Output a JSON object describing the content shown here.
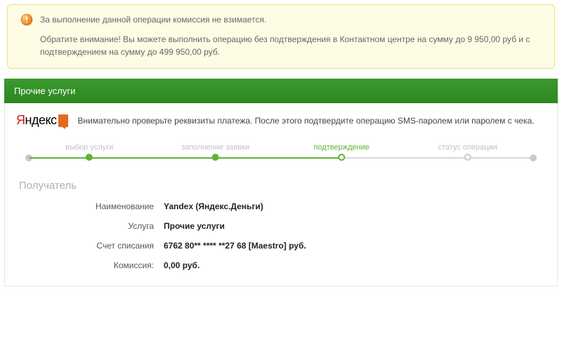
{
  "notice": {
    "line1": "За выполнение данной операции комиссия не взимается.",
    "line2": "Обратите внимание! Вы можете выполнить операцию без подтверждения в Контактном центре на сумму до 9 950,00 руб и с подтверждением на сумму до 499 950,00 руб."
  },
  "section_title": "Прочие услуги",
  "provider": {
    "logo_text_black": "ндекс",
    "logo_text_red": "Я"
  },
  "instructions": "Внимательно проверьте реквизиты платежа. После этого подтвердите операцию SMS-паролем или паролем с чека.",
  "stepper": {
    "steps": [
      {
        "label": "выбор услуги"
      },
      {
        "label": "заполнение заявки"
      },
      {
        "label": "подтверждение"
      },
      {
        "label": "статус операции"
      }
    ]
  },
  "recipient_title": "Получатель",
  "fields": {
    "name_label": "Наименование",
    "name_value": "Yandex (Яндекс.Деньги)",
    "service_label": "Услуга",
    "service_value": "Прочие услуги",
    "account_label": "Счет списания",
    "account_value": "6762 80** **** **27 68  [Maestro]  руб.",
    "fee_label": "Комиссия:",
    "fee_value": "0,00 руб."
  }
}
